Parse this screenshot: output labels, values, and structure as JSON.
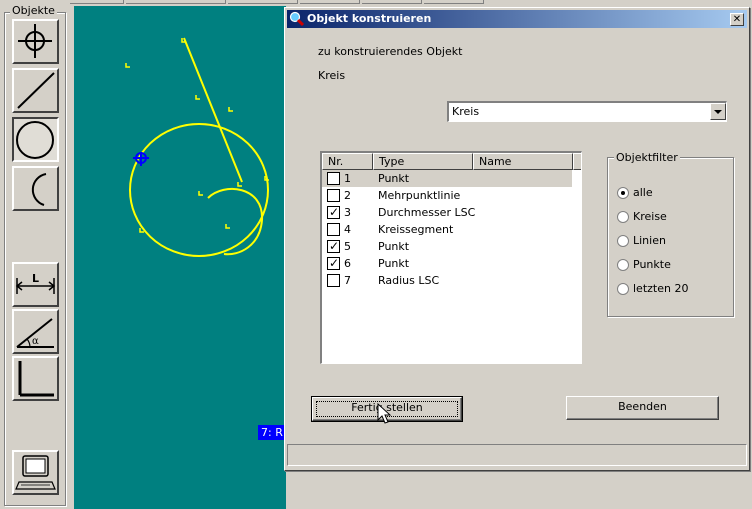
{
  "toolpanel": {
    "legend": "Objekte",
    "tools": [
      {
        "name": "point-tool",
        "icon": "crosshair-icon",
        "pressed": false
      },
      {
        "name": "line-tool",
        "icon": "line-icon",
        "pressed": false
      },
      {
        "name": "circle-tool",
        "icon": "circle-icon",
        "pressed": true
      },
      {
        "name": "arc-tool",
        "icon": "arc-icon",
        "pressed": false
      },
      {
        "name": "distance-tool",
        "icon": "distance-icon",
        "pressed": false
      },
      {
        "name": "angle-tool",
        "icon": "angle-icon",
        "pressed": false
      },
      {
        "name": "right-angle-tool",
        "icon": "right-angle-icon",
        "pressed": false
      },
      {
        "name": "computer-tool",
        "icon": "computer-icon",
        "pressed": false
      }
    ]
  },
  "canvas": {
    "background": "#008080",
    "geometry_color": "#ffff00",
    "label": "7: R"
  },
  "dialog": {
    "title": "Objekt konstruieren",
    "close_label": "✕",
    "object_caption": "zu konstruierendes Objekt",
    "object_value": "Kreis",
    "combo_value": "Kreis",
    "list": {
      "columns": [
        "Nr.",
        "Type",
        "Name"
      ],
      "rows": [
        {
          "nr": "1",
          "type": "Punkt",
          "checked": false,
          "selected": true
        },
        {
          "nr": "2",
          "type": "Mehrpunktlinie",
          "checked": false,
          "selected": false
        },
        {
          "nr": "3",
          "type": "Durchmesser LSC",
          "checked": true,
          "selected": false
        },
        {
          "nr": "4",
          "type": "Kreissegment",
          "checked": false,
          "selected": false
        },
        {
          "nr": "5",
          "type": "Punkt",
          "checked": true,
          "selected": false
        },
        {
          "nr": "6",
          "type": "Punkt",
          "checked": true,
          "selected": false
        },
        {
          "nr": "7",
          "type": "Radius LSC",
          "checked": false,
          "selected": false
        }
      ]
    },
    "filter": {
      "title": "Objektfilter",
      "options": [
        {
          "label": "alle",
          "selected": true
        },
        {
          "label": "Kreise",
          "selected": false
        },
        {
          "label": "Linien",
          "selected": false
        },
        {
          "label": "Punkte",
          "selected": false
        },
        {
          "label": "letzten 20",
          "selected": false
        }
      ]
    },
    "buttons": {
      "finish": "Fertig stellen",
      "quit": "Beenden"
    }
  }
}
